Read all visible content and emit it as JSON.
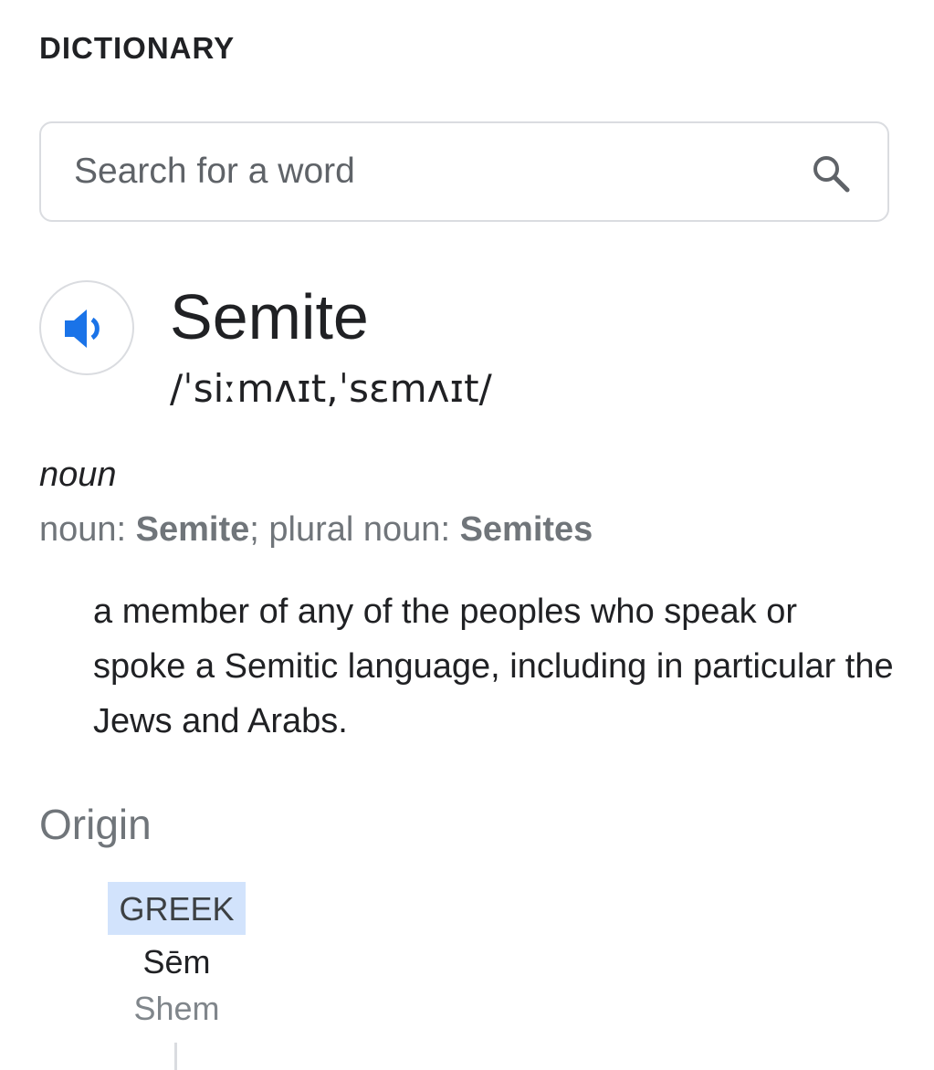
{
  "header": {
    "title": "DICTIONARY"
  },
  "search": {
    "placeholder": "Search for a word",
    "icon": "search-icon"
  },
  "entry": {
    "speaker_icon": "speaker-icon",
    "word": "Semite",
    "phonetic": "/ˈsiːmʌɪt,ˈsɛmʌɪt/",
    "part_of_speech": "noun",
    "forms": {
      "noun_label": "noun: ",
      "noun_value": "Semite",
      "separator": "; ",
      "plural_label": "plural noun: ",
      "plural_value": "Semites"
    },
    "definition": "a member of any of the peoples who speak or spoke a Semitic language, including in particular the Jews and Arabs."
  },
  "origin": {
    "heading": "Origin",
    "nodes": [
      {
        "language": "GREEK",
        "word": "Sēm",
        "gloss": "Shem"
      }
    ]
  },
  "colors": {
    "accent_blue": "#1a73e8",
    "origin_highlight": "#d2e3fc",
    "border": "#dadce0",
    "muted_text": "#70757a"
  }
}
